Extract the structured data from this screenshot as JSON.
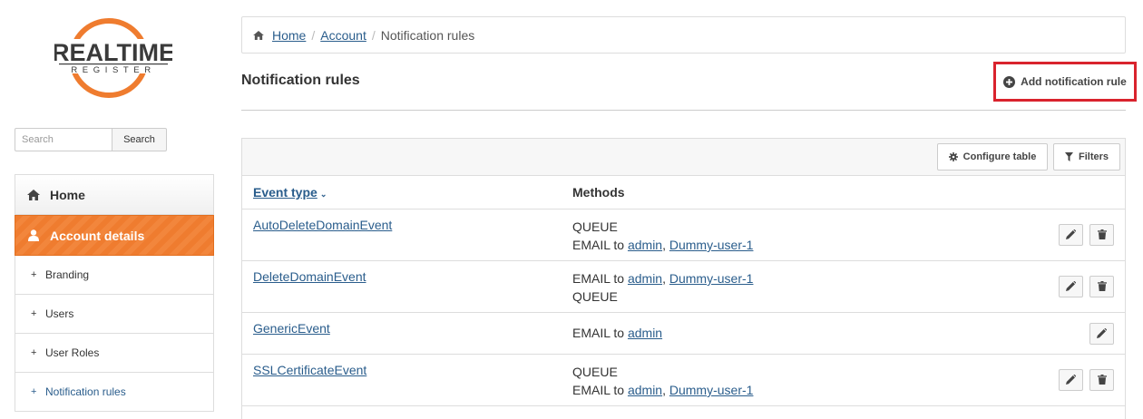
{
  "brand": {
    "logo_line1": "REALTIME",
    "logo_line2": "REGISTER",
    "accent": "#ef7c2f",
    "link_color": "#2a5d8c",
    "highlight": "#d9232d"
  },
  "sidebar": {
    "search": {
      "placeholder": "Search",
      "button_label": "Search"
    },
    "nav": [
      {
        "label": "Home",
        "icon": "home-icon"
      },
      {
        "label": "Account details",
        "icon": "user-icon",
        "active": true
      }
    ],
    "sub_items": [
      {
        "label": "Branding"
      },
      {
        "label": "Users"
      },
      {
        "label": "User Roles"
      },
      {
        "label": "Notification rules",
        "selected": true
      }
    ]
  },
  "breadcrumb": {
    "items": [
      "Home",
      "Account"
    ],
    "current": "Notification rules"
  },
  "page": {
    "title": "Notification rules",
    "add_button_label": "Add notification rule"
  },
  "toolbar": {
    "configure_label": "Configure table",
    "filters_label": "Filters"
  },
  "table": {
    "columns": {
      "event_type": "Event type",
      "methods": "Methods"
    },
    "rows": [
      {
        "event": "AutoDeleteDomainEvent",
        "line1_text": "QUEUE",
        "line2_text": "EMAIL to ",
        "line2_link1": "admin",
        "line2_sep": ", ",
        "line2_link2": "Dummy-user-1"
      },
      {
        "event": "DeleteDomainEvent",
        "line1_text": "EMAIL to ",
        "line1_link1": "admin",
        "line1_sep": ", ",
        "line1_link2": "Dummy-user-1",
        "line2_text": "QUEUE"
      },
      {
        "event": "GenericEvent",
        "line1_text": "EMAIL to ",
        "line1_link1": "admin"
      },
      {
        "event": "SSLCertificateEvent",
        "line1_text": "QUEUE",
        "line2_text": "EMAIL to ",
        "line2_link1": "admin",
        "line2_sep": ", ",
        "line2_link2": "Dummy-user-1"
      }
    ]
  }
}
